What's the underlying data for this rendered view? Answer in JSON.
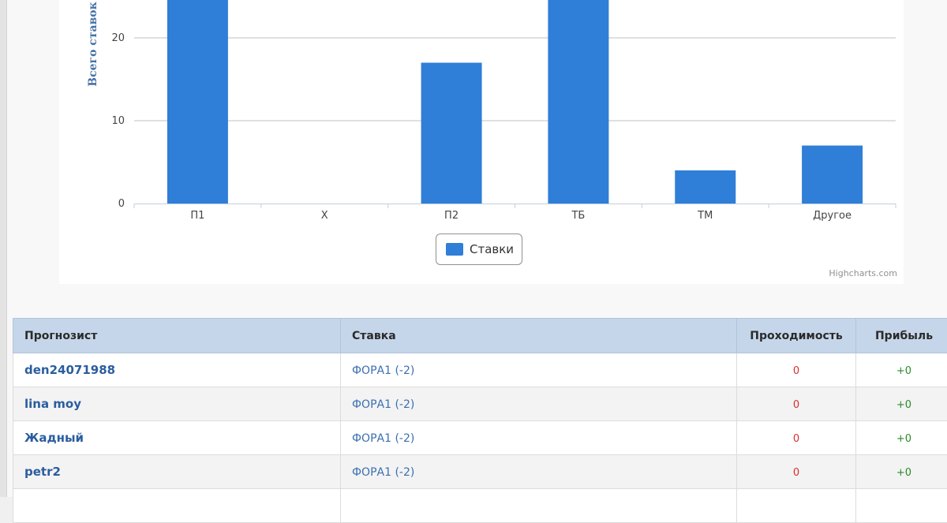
{
  "chart_data": {
    "type": "bar",
    "categories": [
      "П1",
      "Х",
      "П2",
      "ТБ",
      "ТМ",
      "Другое"
    ],
    "series": [
      {
        "name": "Ставки",
        "values": [
          30,
          0,
          17,
          30,
          4,
          7
        ]
      }
    ],
    "ylabel": "Всего ставок",
    "yticks": [
      0,
      10,
      20
    ],
    "ylim": [
      0,
      24.5
    ],
    "legend": "bottom-center",
    "grid": true,
    "credits": "Highcharts.com",
    "colors": {
      "bar": "#2f7ed8"
    }
  },
  "table": {
    "headers": [
      "Прогнозист",
      "Ставка",
      "Проходимость",
      "Прибыль"
    ],
    "rows": [
      {
        "forecaster": "den24071988",
        "bet": "ФОРА1 (-2)",
        "pass_rate": "0",
        "profit": "+0"
      },
      {
        "forecaster": "lina moy",
        "bet": "ФОРА1 (-2)",
        "pass_rate": "0",
        "profit": "+0"
      },
      {
        "forecaster": "Жадный",
        "bet": "ФОРА1 (-2)",
        "pass_rate": "0",
        "profit": "+0"
      },
      {
        "forecaster": "petr2",
        "bet": "ФОРА1 (-2)",
        "pass_rate": "0",
        "profit": "+0"
      },
      {
        "forecaster": "",
        "bet": "",
        "pass_rate": "",
        "profit": ""
      }
    ]
  }
}
